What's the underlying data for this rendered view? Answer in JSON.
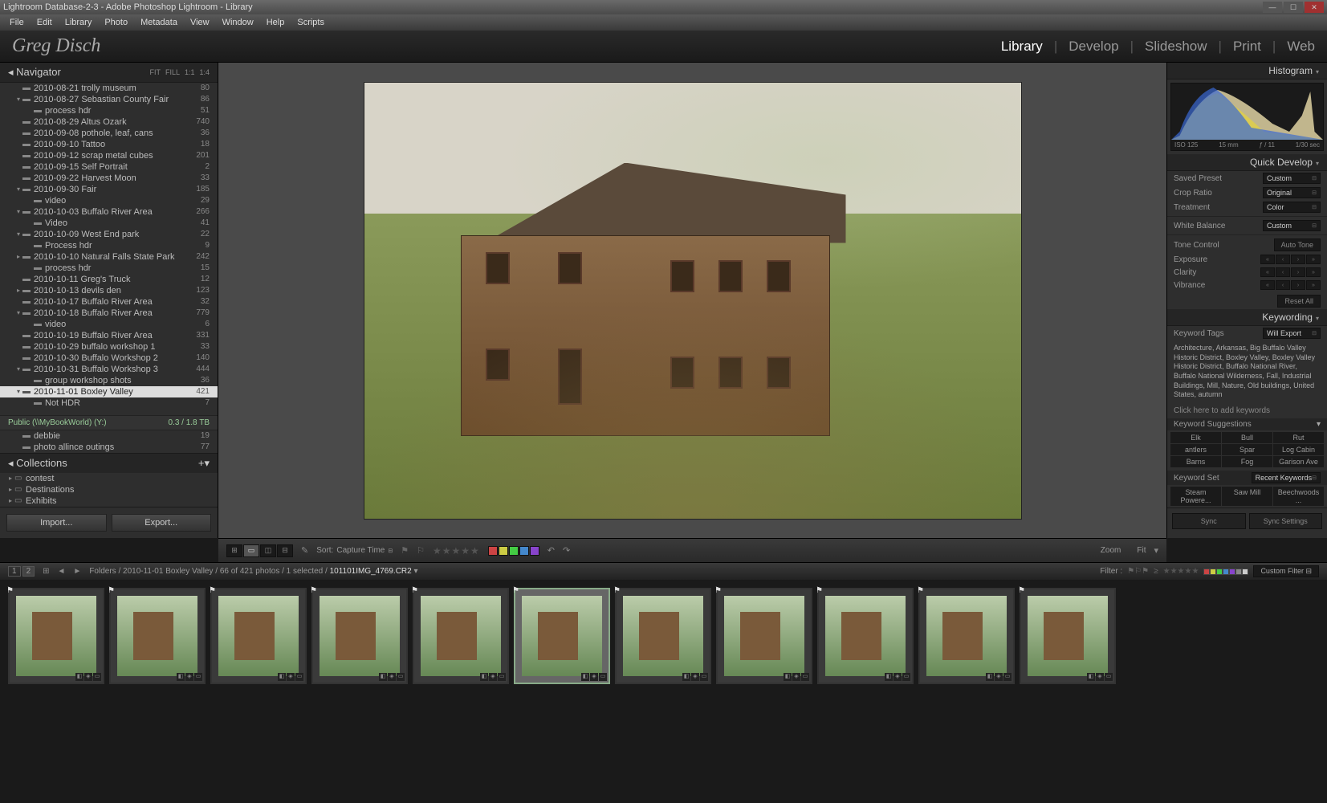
{
  "titlebar": "Lightroom Database-2-3 - Adobe Photoshop Lightroom - Library",
  "menu": [
    "File",
    "Edit",
    "Library",
    "Photo",
    "Metadata",
    "View",
    "Window",
    "Help",
    "Scripts"
  ],
  "logo": "Greg Disch",
  "modules": [
    "Library",
    "Develop",
    "Slideshow",
    "Print",
    "Web"
  ],
  "active_module": "Library",
  "navigator": {
    "title": "Navigator",
    "opts": [
      "FIT",
      "FILL",
      "1:1",
      "1:4"
    ]
  },
  "folders": [
    {
      "ind": 2,
      "tri": "",
      "name": "2010-08-21 trolly museum",
      "count": 80
    },
    {
      "ind": 2,
      "tri": "▾",
      "name": "2010-08-27 Sebastian County Fair",
      "count": 86
    },
    {
      "ind": 3,
      "tri": "",
      "name": "process hdr",
      "count": 51
    },
    {
      "ind": 2,
      "tri": "",
      "name": "2010-08-29 Altus Ozark",
      "count": 740
    },
    {
      "ind": 2,
      "tri": "",
      "name": "2010-09-08 pothole, leaf, cans",
      "count": 36
    },
    {
      "ind": 2,
      "tri": "",
      "name": "2010-09-10 Tattoo",
      "count": 18
    },
    {
      "ind": 2,
      "tri": "",
      "name": "2010-09-12 scrap metal cubes",
      "count": 201
    },
    {
      "ind": 2,
      "tri": "",
      "name": "2010-09-15 Self Portrait",
      "count": 2
    },
    {
      "ind": 2,
      "tri": "",
      "name": "2010-09-22 Harvest Moon",
      "count": 33
    },
    {
      "ind": 2,
      "tri": "▾",
      "name": "2010-09-30 Fair",
      "count": 185
    },
    {
      "ind": 3,
      "tri": "",
      "name": "video",
      "count": 29
    },
    {
      "ind": 2,
      "tri": "▾",
      "name": "2010-10-03 Buffalo River Area",
      "count": 266
    },
    {
      "ind": 3,
      "tri": "",
      "name": "Video",
      "count": 41
    },
    {
      "ind": 2,
      "tri": "▾",
      "name": "2010-10-09 West End park",
      "count": 22
    },
    {
      "ind": 3,
      "tri": "",
      "name": "Process hdr",
      "count": 9
    },
    {
      "ind": 2,
      "tri": "▸",
      "name": "2010-10-10 Natural Falls State Park",
      "count": 242
    },
    {
      "ind": 3,
      "tri": "",
      "name": "process hdr",
      "count": 15
    },
    {
      "ind": 2,
      "tri": "",
      "name": "2010-10-11 Greg's Truck",
      "count": 12
    },
    {
      "ind": 2,
      "tri": "▸",
      "name": "2010-10-13 devils den",
      "count": 123
    },
    {
      "ind": 2,
      "tri": "",
      "name": "2010-10-17 Buffalo River Area",
      "count": 32
    },
    {
      "ind": 2,
      "tri": "▾",
      "name": "2010-10-18 Buffalo River Area",
      "count": 779
    },
    {
      "ind": 3,
      "tri": "",
      "name": "video",
      "count": 6
    },
    {
      "ind": 2,
      "tri": "",
      "name": "2010-10-19 Buffalo River Area",
      "count": 331
    },
    {
      "ind": 2,
      "tri": "",
      "name": "2010-10-29 buffalo workshop 1",
      "count": 33
    },
    {
      "ind": 2,
      "tri": "",
      "name": "2010-10-30 Buffalo Workshop 2",
      "count": 140
    },
    {
      "ind": 2,
      "tri": "▾",
      "name": "2010-10-31 Buffalo Workshop 3",
      "count": 444
    },
    {
      "ind": 3,
      "tri": "",
      "name": "group workshop shots",
      "count": 36
    },
    {
      "ind": 2,
      "tri": "▾",
      "name": "2010-11-01 Boxley Valley",
      "count": 421,
      "sel": true
    },
    {
      "ind": 3,
      "tri": "",
      "name": "Not HDR",
      "count": 7
    }
  ],
  "drive": {
    "name": "Public (\\\\MyBookWorld) (Y:)",
    "space": "0.3 / 1.8 TB"
  },
  "drive_folders": [
    {
      "ind": 2,
      "name": "debbie",
      "count": 19
    },
    {
      "ind": 2,
      "name": "photo allince outings",
      "count": 77
    }
  ],
  "collections": {
    "title": "Collections",
    "items": [
      "contest",
      "Destinations",
      "Exhibits"
    ]
  },
  "import_btn": "Import...",
  "export_btn": "Export...",
  "histogram_title": "Histogram",
  "histo_info": {
    "iso": "ISO 125",
    "focal": "15 mm",
    "aperture": "ƒ / 11",
    "shutter": "1/30 sec"
  },
  "quickdev": {
    "title": "Quick Develop",
    "preset_lbl": "Saved Preset",
    "preset_val": "Custom",
    "crop_lbl": "Crop Ratio",
    "crop_val": "Original",
    "treat_lbl": "Treatment",
    "treat_val": "Color",
    "wb_lbl": "White Balance",
    "wb_val": "Custom",
    "tone_lbl": "Tone Control",
    "autotone": "Auto Tone",
    "exposure": "Exposure",
    "clarity": "Clarity",
    "vibrance": "Vibrance",
    "reset": "Reset All"
  },
  "keywording": {
    "title": "Keywording",
    "tags_lbl": "Keyword Tags",
    "tags_mode": "Will Export",
    "keywords": "Architecture, Arkansas, Big Buffalo Valley Historic District, Boxley Valley, Boxley Valley Historic District, Buffalo National River, Buffalo National Wilderness, Fall, Industrial Buildings, Mill, Nature, Old buildings, United States, autumn",
    "addprompt": "Click here to add keywords",
    "sugg_lbl": "Keyword Suggestions",
    "suggestions": [
      "Elk",
      "Bull",
      "Rut",
      "antlers",
      "Spar",
      "Log Cabin",
      "Barns",
      "Fog",
      "Garison Ave"
    ],
    "set_lbl": "Keyword Set",
    "set_val": "Recent Keywords",
    "recent": [
      "Steam Powere...",
      "Saw Mill",
      "Beechwoods ..."
    ]
  },
  "sync": "Sync",
  "sync_settings": "Sync Settings",
  "toolbar": {
    "sort_lbl": "Sort:",
    "sort_val": "Capture Time",
    "zoom_lbl": "Zoom",
    "fit": "Fit",
    "colors": [
      "#c44",
      "#cc4",
      "#4c4",
      "#48c",
      "#84c"
    ]
  },
  "status": {
    "path1": "Folders / 2010-11-01 Boxley Valley / 66 of 421 photos / 1 selected / ",
    "filename": "101101IMG_4769.CR2",
    "filter_lbl": "Filter :",
    "customfilter": "Custom Filter"
  },
  "thumbs": [
    0,
    1,
    2,
    3,
    4,
    5,
    6,
    7,
    8,
    9,
    10
  ],
  "selected_thumb": 5
}
